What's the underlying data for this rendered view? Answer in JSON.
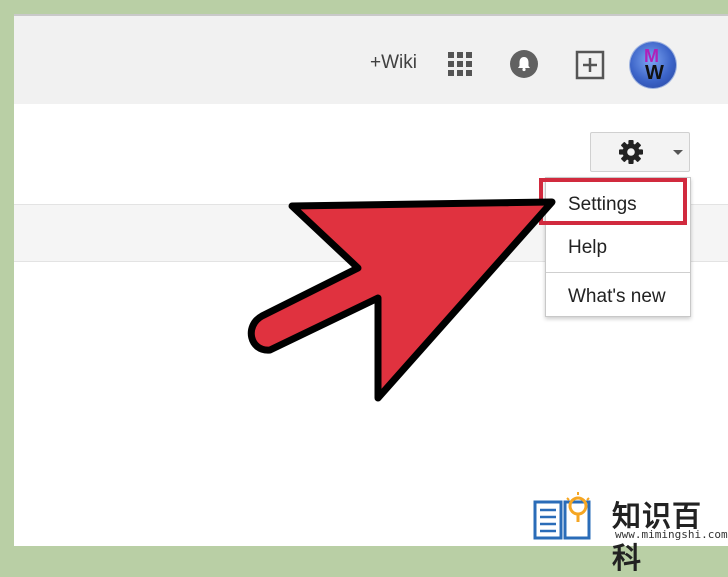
{
  "header": {
    "wiki_link": "+Wiki",
    "avatar_letters": [
      "M",
      "W"
    ]
  },
  "icons": {
    "apps": "grid-apps-icon",
    "notifications": "bell-icon",
    "share": "add-box-icon",
    "settings": "gear-icon",
    "dropdown": "caret-down-icon"
  },
  "settings_menu": {
    "items": [
      "Settings",
      "Help",
      "What's new"
    ],
    "highlighted": "Settings"
  },
  "watermark": {
    "title": "知识百科",
    "url": "www.mimingshi.com"
  },
  "colors": {
    "frame": "#b9cfa5",
    "topbar": "#f1f1f1",
    "arrow_fill": "#e0323f",
    "highlight_border": "#d12a3e",
    "watermark_icon": "#2a6cb8",
    "watermark_bulb": "#f5a623"
  }
}
